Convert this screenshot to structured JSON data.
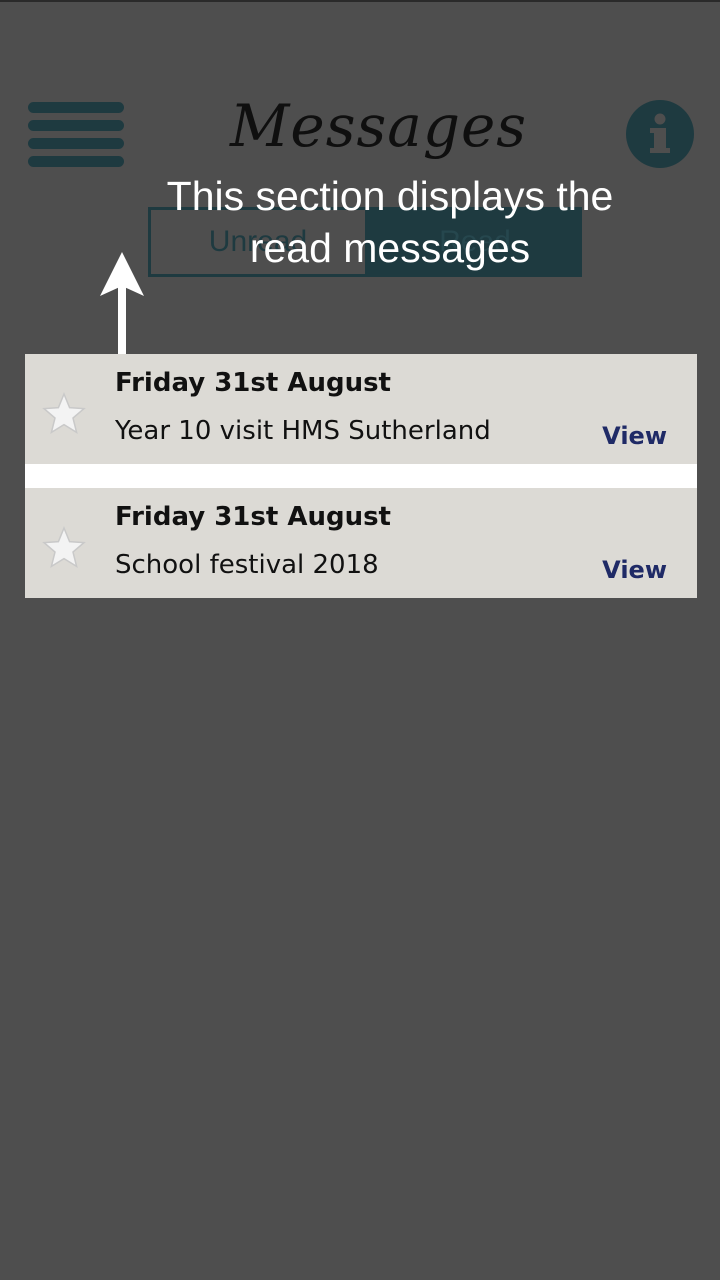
{
  "header": {
    "title": "Messages"
  },
  "tabs": [
    {
      "label": "Unread"
    },
    {
      "label": "Read"
    }
  ],
  "tooltip": {
    "text": "This section displays the read messages"
  },
  "messages": [
    {
      "date": "Friday 31st August",
      "subject": "Year 10 visit HMS Sutherland",
      "action": "View"
    },
    {
      "date": "Friday 31st August",
      "subject": "School festival 2018",
      "action": "View"
    }
  ],
  "colors": {
    "overlay_background": "#4e4e4e",
    "accent": "#1e3a40",
    "card_background": "#dcdad5",
    "view_link": "#1f2a66"
  },
  "icons": {
    "menu": "hamburger-menu-icon",
    "info": "info-icon",
    "star": "star-icon",
    "arrow": "arrow-up-icon"
  }
}
